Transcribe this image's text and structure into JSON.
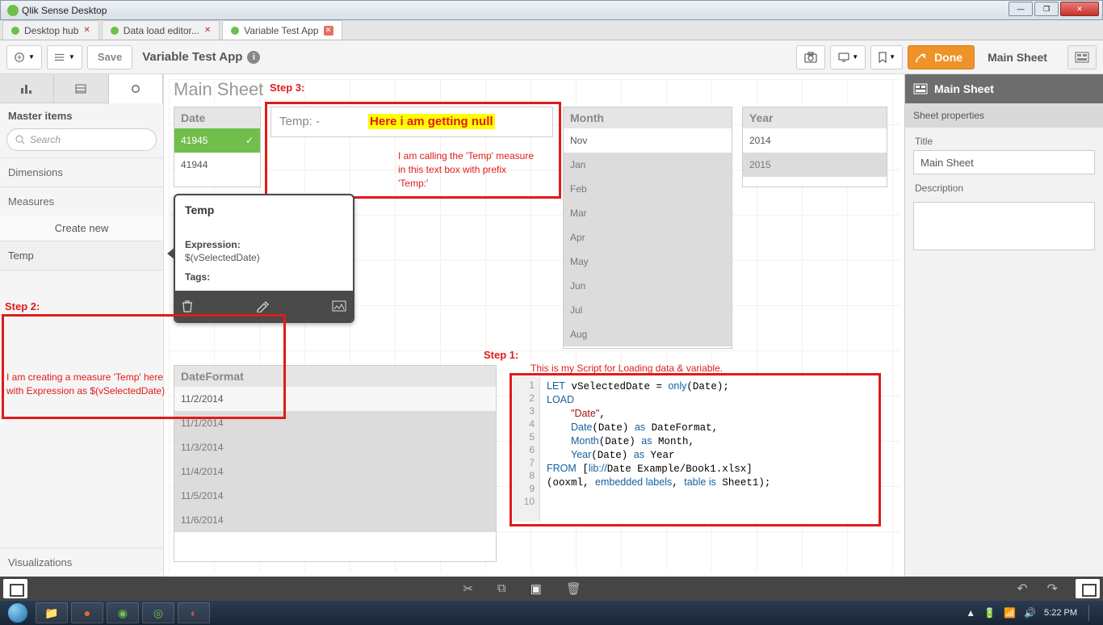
{
  "window": {
    "title": "Qlik Sense Desktop"
  },
  "tabs": [
    {
      "label": "Desktop hub"
    },
    {
      "label": "Data load editor..."
    },
    {
      "label": "Variable Test App"
    }
  ],
  "toolbar": {
    "save": "Save",
    "app_name": "Variable Test App",
    "done": "Done",
    "sheet_label": "Main Sheet"
  },
  "left": {
    "header": "Master items",
    "search_placeholder": "Search",
    "dimensions": "Dimensions",
    "measures": "Measures",
    "create_new": "Create new",
    "measure_temp": "Temp",
    "visualizations": "Visualizations"
  },
  "popup": {
    "title": "Temp",
    "expr_label": "Expression:",
    "expr_value": "$(vSelectedDate)",
    "tags_label": "Tags:"
  },
  "canvas": {
    "title": "Main Sheet",
    "date_header": "Date",
    "date_rows": [
      "41945",
      "41944"
    ],
    "temp_header": "Temp: -",
    "month_header": "Month",
    "months": [
      "Nov",
      "Jan",
      "Feb",
      "Mar",
      "Apr",
      "May",
      "Jun",
      "Jul",
      "Aug"
    ],
    "year_header": "Year",
    "years": [
      "2014",
      "2015"
    ],
    "dateformat_header": "DateFormat",
    "dateformat_rows": [
      "11/2/2014",
      "11/1/2014",
      "11/3/2014",
      "11/4/2014",
      "11/5/2014",
      "11/6/2014"
    ]
  },
  "ann": {
    "step1": "Step 1:",
    "step1_text": "This is my Script for Loading data & variable.",
    "step2": "Step 2:",
    "step2_text1": "I am creating a measure 'Temp' here",
    "step2_text2": "with Expression as $(vSelectedDate)",
    "step3": "Step 3:",
    "step3_hl": "Here i am getting null",
    "step3_t1": "I am calling the 'Temp' measure",
    "step3_t2": "in this text box with prefix",
    "step3_t3": "'Temp:'"
  },
  "code_lines": [
    "1",
    "2",
    "3",
    "4",
    "5",
    "6",
    "7",
    "8",
    "9",
    "10"
  ],
  "right": {
    "title": "Main Sheet",
    "sub": "Sheet properties",
    "title_label": "Title",
    "title_value": "Main Sheet",
    "desc_label": "Description"
  },
  "tray": {
    "time": "5:22 PM"
  }
}
